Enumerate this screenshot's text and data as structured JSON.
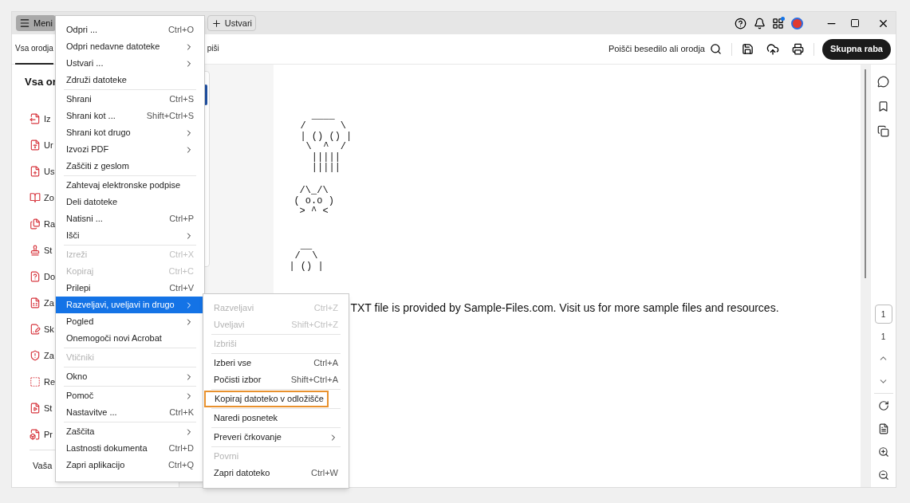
{
  "title_bar": {
    "menu_button": "Meni",
    "create_button": "Ustvari"
  },
  "toolbar": {
    "tabs": [
      {
        "label": "Vsa orodja",
        "selected": true
      },
      {
        "label": "piši",
        "selected": false
      }
    ],
    "search_label": "Poišči besedilo ali orodja",
    "share_button": "Skupna raba"
  },
  "tools_panel": {
    "heading": "Vsa or",
    "items": [
      "Iz",
      "Ur",
      "Us",
      "Zo",
      "Ra",
      "St",
      "Do",
      "Za",
      "Sk",
      "Za",
      "Re",
      "St",
      "Pr"
    ],
    "footer": "Vaša"
  },
  "document": {
    "ascii_art": [
      [
        "  ____",
        "/      \\",
        "| () () |",
        " \\  ^  /",
        "  |||||",
        "  |||||"
      ],
      [
        " /\\_/\\",
        "( o.o )",
        " > ^ <"
      ],
      [
        "  __",
        " /  \\",
        "| () |"
      ]
    ],
    "text": "TXT file is provided by Sample-Files.com. Visit us for more sample files and resources."
  },
  "page_nav": {
    "current_page": "1",
    "total_pages": "1"
  },
  "menu": {
    "items": [
      {
        "kind": "item",
        "label": "Odpri ...",
        "shortcut": "Ctrl+O",
        "submenu": false,
        "disabled": false,
        "selected": false
      },
      {
        "kind": "item",
        "label": "Odpri nedavne datoteke",
        "submenu": true,
        "disabled": false,
        "selected": false
      },
      {
        "kind": "item",
        "label": "Ustvari ...",
        "submenu": true,
        "disabled": false,
        "selected": false
      },
      {
        "kind": "item",
        "label": "Združi datoteke",
        "submenu": false,
        "disabled": false,
        "selected": false
      },
      {
        "kind": "separator"
      },
      {
        "kind": "item",
        "label": "Shrani",
        "shortcut": "Ctrl+S",
        "submenu": false,
        "disabled": false,
        "selected": false
      },
      {
        "kind": "item",
        "label": "Shrani kot ...",
        "shortcut": "Shift+Ctrl+S",
        "submenu": false,
        "disabled": false,
        "selected": false
      },
      {
        "kind": "item",
        "label": "Shrani kot drugo",
        "submenu": true,
        "disabled": false,
        "selected": false
      },
      {
        "kind": "item",
        "label": "Izvozi PDF",
        "submenu": true,
        "disabled": false,
        "selected": false
      },
      {
        "kind": "item",
        "label": "Zaščiti z geslom",
        "submenu": false,
        "disabled": false,
        "selected": false
      },
      {
        "kind": "separator"
      },
      {
        "kind": "item",
        "label": "Zahtevaj elektronske podpise",
        "submenu": false,
        "disabled": false,
        "selected": false
      },
      {
        "kind": "item",
        "label": "Deli datoteke",
        "submenu": false,
        "disabled": false,
        "selected": false
      },
      {
        "kind": "item",
        "label": "Natisni ...",
        "shortcut": "Ctrl+P",
        "submenu": false,
        "disabled": false,
        "selected": false
      },
      {
        "kind": "item",
        "label": "Išči",
        "submenu": true,
        "disabled": false,
        "selected": false
      },
      {
        "kind": "separator"
      },
      {
        "kind": "item",
        "label": "Izreži",
        "shortcut": "Ctrl+X",
        "submenu": false,
        "disabled": true,
        "selected": false
      },
      {
        "kind": "item",
        "label": "Kopiraj",
        "shortcut": "Ctrl+C",
        "submenu": false,
        "disabled": true,
        "selected": false
      },
      {
        "kind": "item",
        "label": "Prilepi",
        "shortcut": "Ctrl+V",
        "submenu": false,
        "disabled": false,
        "selected": false
      },
      {
        "kind": "item",
        "label": "Razveljavi, uveljavi in drugo",
        "submenu": true,
        "disabled": false,
        "selected": true
      },
      {
        "kind": "item",
        "label": "Pogled",
        "submenu": true,
        "disabled": false,
        "selected": false
      },
      {
        "kind": "item",
        "label": "Onemogoči novi Acrobat",
        "submenu": false,
        "disabled": false,
        "selected": false
      },
      {
        "kind": "separator"
      },
      {
        "kind": "item",
        "label": "Vtičniki",
        "submenu": false,
        "disabled": true,
        "selected": false
      },
      {
        "kind": "separator"
      },
      {
        "kind": "item",
        "label": "Okno",
        "submenu": true,
        "disabled": false,
        "selected": false
      },
      {
        "kind": "separator"
      },
      {
        "kind": "item",
        "label": "Pomoč",
        "submenu": true,
        "disabled": false,
        "selected": false
      },
      {
        "kind": "item",
        "label": "Nastavitve ...",
        "shortcut": "Ctrl+K",
        "submenu": false,
        "disabled": false,
        "selected": false
      },
      {
        "kind": "separator"
      },
      {
        "kind": "item",
        "label": "Zaščita",
        "submenu": true,
        "disabled": false,
        "selected": false
      },
      {
        "kind": "item",
        "label": "Lastnosti dokumenta",
        "shortcut": "Ctrl+D",
        "submenu": false,
        "disabled": false,
        "selected": false
      },
      {
        "kind": "item",
        "label": "Zapri aplikacijo",
        "shortcut": "Ctrl+Q",
        "submenu": false,
        "disabled": false,
        "selected": false
      }
    ]
  },
  "submenu": {
    "items": [
      {
        "kind": "item",
        "label": "Razveljavi",
        "shortcut": "Ctrl+Z",
        "submenu": false,
        "disabled": true,
        "highlighted": false
      },
      {
        "kind": "item",
        "label": "Uveljavi",
        "shortcut": "Shift+Ctrl+Z",
        "submenu": false,
        "disabled": true,
        "highlighted": false
      },
      {
        "kind": "separator"
      },
      {
        "kind": "item",
        "label": "Izbriši",
        "submenu": false,
        "disabled": true,
        "highlighted": false
      },
      {
        "kind": "separator"
      },
      {
        "kind": "item",
        "label": "Izberi vse",
        "shortcut": "Ctrl+A",
        "submenu": false,
        "disabled": false,
        "highlighted": false
      },
      {
        "kind": "item",
        "label": "Počisti izbor",
        "shortcut": "Shift+Ctrl+A",
        "submenu": false,
        "disabled": false,
        "highlighted": false
      },
      {
        "kind": "separator"
      },
      {
        "kind": "item",
        "label": "Kopiraj datoteko v odložišče",
        "submenu": false,
        "disabled": false,
        "highlighted": true
      },
      {
        "kind": "separator"
      },
      {
        "kind": "item",
        "label": "Naredi posnetek",
        "submenu": false,
        "disabled": false,
        "highlighted": false
      },
      {
        "kind": "separator"
      },
      {
        "kind": "item",
        "label": "Preveri črkovanje",
        "submenu": true,
        "disabled": false,
        "highlighted": false
      },
      {
        "kind": "separator"
      },
      {
        "kind": "item",
        "label": "Povrni",
        "submenu": false,
        "disabled": true,
        "highlighted": false
      },
      {
        "kind": "item",
        "label": "Zapri datoteko",
        "shortcut": "Ctrl+W",
        "submenu": false,
        "disabled": false,
        "highlighted": false
      }
    ]
  }
}
